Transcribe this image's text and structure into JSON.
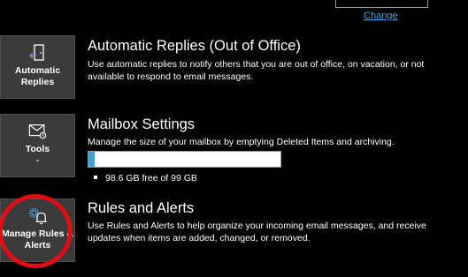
{
  "top": {
    "change_link": "Change"
  },
  "tiles": [
    {
      "label": "Automatic Replies",
      "icon": "door-arrow-icon"
    },
    {
      "label": "Tools",
      "icon": "envelope-tools-icon",
      "has_dropdown": true
    },
    {
      "label": "Manage Rules & Alerts",
      "icon": "gear-bell-icon"
    }
  ],
  "sections": {
    "auto_replies": {
      "title": "Automatic Replies (Out of Office)",
      "description": "Use automatic replies to notify others that you are out of office, on vacation, or not available to respond to email messages."
    },
    "mailbox": {
      "title": "Mailbox Settings",
      "description": "Manage the size of your mailbox by emptying Deleted Items and archiving.",
      "usage_fraction": 0.006,
      "quota_text": "98.6 GB free of 99 GB"
    },
    "rules": {
      "title": "Rules and Alerts",
      "description": "Use Rules and Alerts to help organize your incoming email messages, and receive updates when items are added, changed, or removed."
    }
  },
  "colors": {
    "background": "#000000",
    "tile": "#3b3b3b",
    "link": "#4da3e6",
    "progress_fill": "#3ba1d9",
    "highlight_circle": "#e00d13",
    "icon_accent": "#b36ad6"
  }
}
